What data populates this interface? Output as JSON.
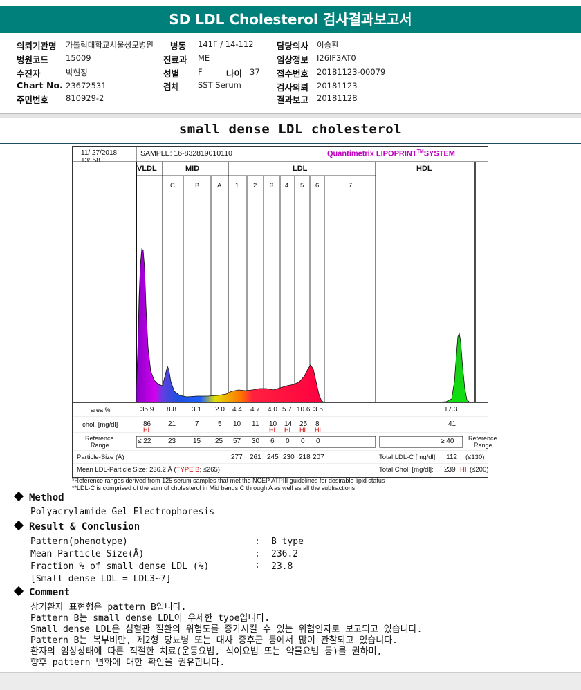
{
  "report_title": "SD LDL Cholesterol 검사결과보고서",
  "header": {
    "institution_label": "의뢰기관명",
    "institution": "가톨릭대학교서울성모병원",
    "ward_label": "병동",
    "ward": "141F / 14-112",
    "doctor_label": "담당의사",
    "doctor": "이승환",
    "hospital_code_label": "병원코드",
    "hospital_code": "15009",
    "dept_label": "진료과",
    "dept": "ME",
    "clinical_info_label": "임상정보",
    "clinical_info": "I26IF3AT0",
    "patient_label": "수진자",
    "patient": "박현정",
    "sex_label": "성별",
    "sex": "F",
    "age_label": "나이",
    "age": "37",
    "receipt_label": "접수번호",
    "receipt": "20181123-00079",
    "chart_label": "Chart No.",
    "chart": "23672531",
    "specimen_label": "검체",
    "specimen": "SST Serum",
    "request_date_label": "검사의뢰",
    "request_date": "20181123",
    "id_label": "주민번호",
    "id": "810929-2",
    "report_date_label": "결과보고",
    "report_date": "20181128"
  },
  "subtitle": "small dense LDL cholesterol",
  "lipoprint": {
    "datetime_line1": "11/ 27/2018",
    "datetime_line2": "13: 58",
    "sample": "SAMPLE:   16-832819010110",
    "brand": "Quantimetrix LIPOPRINT",
    "brand_tm": "TM",
    "brand_suffix": "SYSTEM",
    "groups": [
      "VLDL",
      "MID",
      "LDL",
      "HDL"
    ],
    "mid_bands": [
      "C",
      "B",
      "A"
    ],
    "ldl_bands": [
      "1",
      "2",
      "3",
      "4",
      "5",
      "6",
      "7"
    ],
    "area_label": "area %",
    "area_values": [
      "35.9",
      "8.8",
      "3.1",
      "2.0",
      "4.4",
      "4.7",
      "4.0",
      "5.7",
      "10.6",
      "3.5"
    ],
    "area_hdl": "17.3",
    "chol_label": "chol. [mg/dl]",
    "chol_values": [
      "86",
      "21",
      "7",
      "5",
      "10",
      "11",
      "10",
      "14",
      "25",
      "8"
    ],
    "chol_flags": [
      "HI",
      "",
      "",
      "",
      "",
      "",
      "HI",
      "HI",
      "HI",
      "HI"
    ],
    "chol_hdl": "41",
    "ref_label_1": "Reference",
    "ref_label_2": "Range",
    "ref_values": [
      "≤ 22",
      "23",
      "15",
      "25",
      "57",
      "30",
      "6",
      "0",
      "0",
      "0"
    ],
    "ref_hdl": "≥ 40",
    "particle_label": "Particle-Size (Å)",
    "particle_values": [
      "277",
      "261",
      "245",
      "230",
      "218",
      "207"
    ],
    "total_ldl_label": "Total LDL-C [mg/dl]:",
    "total_ldl": "112",
    "total_ldl_ref": "(≤130)",
    "mean_label": "Mean LDL-Particle Size:",
    "mean_value": "236.2 Å",
    "mean_type": "TYPE B",
    "mean_ref": "≤265",
    "total_chol_label": "Total Chol. [mg/dl]:",
    "total_chol": "239",
    "total_chol_flag": "HI",
    "total_chol_ref": "(≤200)"
  },
  "footnote_1": "*Reference ranges derived from 125 serum samples that met the NCEP ATPIII guidelines for desirable lipid status",
  "footnote_2": "**LDL-C is comprised of the sum of cholesterol in Mid bands C through A as well as all the subfractions",
  "method": {
    "heading": "Method",
    "text": "Polyacrylamide Gel Electrophoresis"
  },
  "result": {
    "heading": "Result & Conclusion",
    "rows": [
      {
        "label": "Pattern(phenotype)",
        "value": "B type"
      },
      {
        "label": "Mean Particle Size(Å)",
        "value": "236.2"
      },
      {
        "label": "Fraction % of small dense LDL (%)",
        "value": "23.8"
      }
    ],
    "note": "[Small dense LDL = LDL3~7]"
  },
  "comment": {
    "heading": "Comment",
    "lines": [
      "상기환자 표현형은 pattern B입니다.",
      "Pattern B는 small dense LDL이 우세한 type입니다.",
      "Small dense LDL은 심혈관 질환의 위험도를 증가시킬 수 있는 위험인자로 보고되고 있습니다.",
      "Pattern B는 복부비만, 제2형 당뇨병 또는 대사 증후군 등에서 많이 관찰되고 있습니다.",
      "환자의 임상상태에 따른 적절한 치료(운동요법, 식이요법 또는 약물요법 등)를 권하며,",
      "향후 pattern 변화에 대한 확인을 권유합니다."
    ]
  }
}
